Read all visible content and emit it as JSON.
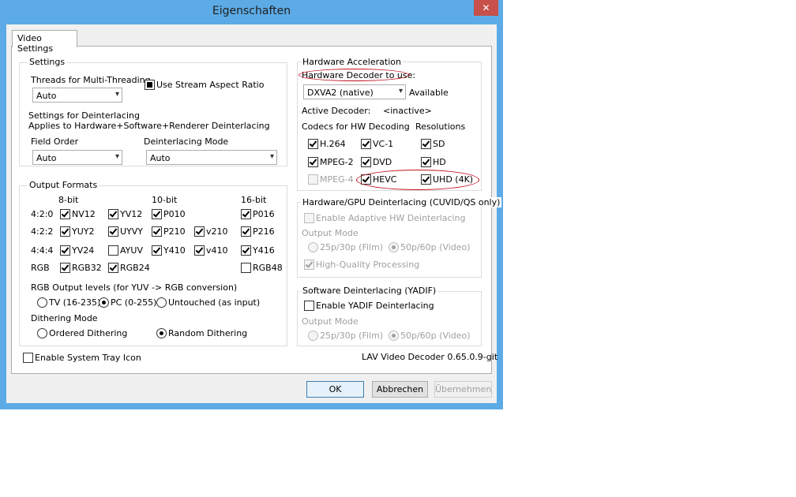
{
  "window": {
    "title": "Eigenschaften",
    "close_glyph": "✕"
  },
  "tabs": [
    {
      "label": "Video Settings"
    }
  ],
  "settings": {
    "title": "Settings",
    "threads_label": "Threads for Multi-Threading",
    "threads_value": "Auto",
    "stream_aspect_label": "Use Stream Aspect Ratio",
    "deint_title": "Settings for Deinterlacing",
    "deint_desc": "Applies to Hardware+Software+Renderer Deinterlacing",
    "field_order_label": "Field Order",
    "field_order_value": "Auto",
    "deint_mode_label": "Deinterlacing Mode",
    "deint_mode_value": "Auto"
  },
  "output_formats": {
    "title": "Output Formats",
    "col_8bit": "8-bit",
    "col_10bit": "10-bit",
    "col_16bit": "16-bit",
    "rows": [
      {
        "label": "4:2:0",
        "items": [
          {
            "label": "NV12",
            "checked": true
          },
          {
            "label": "YV12",
            "checked": true
          },
          {
            "label": "P010",
            "checked": true
          },
          {
            "label": "P016",
            "checked": true
          }
        ]
      },
      {
        "label": "4:2:2",
        "items": [
          {
            "label": "YUY2",
            "checked": true
          },
          {
            "label": "UYVY",
            "checked": true
          },
          {
            "label": "P210",
            "checked": true
          },
          {
            "label": "v210",
            "checked": true
          },
          {
            "label": "P216",
            "checked": true
          }
        ]
      },
      {
        "label": "4:4:4",
        "items": [
          {
            "label": "YV24",
            "checked": true
          },
          {
            "label": "AYUV",
            "checked": false
          },
          {
            "label": "Y410",
            "checked": true
          },
          {
            "label": "v410",
            "checked": true
          },
          {
            "label": "Y416",
            "checked": true
          }
        ]
      },
      {
        "label": "RGB",
        "items": [
          {
            "label": "RGB32",
            "checked": true
          },
          {
            "label": "RGB24",
            "checked": true
          },
          {
            "label": "RGB48",
            "checked": false
          }
        ]
      }
    ],
    "rgb_levels_label": "RGB Output levels (for YUV -> RGB conversion)",
    "rgb_levels": [
      {
        "label": "TV (16-235)",
        "selected": false
      },
      {
        "label": "PC (0-255)",
        "selected": true
      },
      {
        "label": "Untouched (as input)",
        "selected": false
      }
    ],
    "dithering_label": "Dithering Mode",
    "dithering": [
      {
        "label": "Ordered Dithering",
        "selected": false
      },
      {
        "label": "Random Dithering",
        "selected": true
      }
    ]
  },
  "system_tray_label": "Enable System Tray Icon",
  "hw_accel": {
    "title": "Hardware Acceleration",
    "decoder_label": "Hardware Decoder to use:",
    "decoder_value": "DXVA2 (native)",
    "available_label": "Available",
    "active_decoder_label": "Active Decoder:",
    "active_decoder_value": "<inactive>",
    "codecs_label": "Codecs for HW Decoding",
    "resolutions_label": "Resolutions",
    "codecs": [
      {
        "label": "H.264",
        "checked": true
      },
      {
        "label": "VC-1",
        "checked": true
      },
      {
        "label": "MPEG-2",
        "checked": true
      },
      {
        "label": "DVD",
        "checked": true
      },
      {
        "label": "MPEG-4",
        "checked": false,
        "disabled": true
      },
      {
        "label": "HEVC",
        "checked": true
      }
    ],
    "resolutions": [
      {
        "label": "SD",
        "checked": true
      },
      {
        "label": "HD",
        "checked": true
      },
      {
        "label": "UHD (4K)",
        "checked": true
      }
    ]
  },
  "hw_deint": {
    "title": "Hardware/GPU Deinterlacing (CUVID/QS only)",
    "adaptive_label": "Enable Adaptive HW Deinterlacing",
    "output_mode_label": "Output Mode",
    "mode_film": "25p/30p (Film)",
    "mode_video": "50p/60p (Video)",
    "hq_label": "High-Quality Processing"
  },
  "sw_deint": {
    "title": "Software Deinterlacing (YADIF)",
    "yadif_label": "Enable YADIF Deinterlacing",
    "output_mode_label": "Output Mode",
    "mode_film": "25p/30p (Film)",
    "mode_video": "50p/60p (Video)"
  },
  "version": "LAV Video Decoder 0.65.0.9-git",
  "buttons": {
    "ok": "OK",
    "cancel": "Abbrechen",
    "apply": "Übernehmen"
  },
  "colors": {
    "frame": "#5cabe6",
    "close": "#c7504a",
    "annotation": "#c3121f"
  }
}
